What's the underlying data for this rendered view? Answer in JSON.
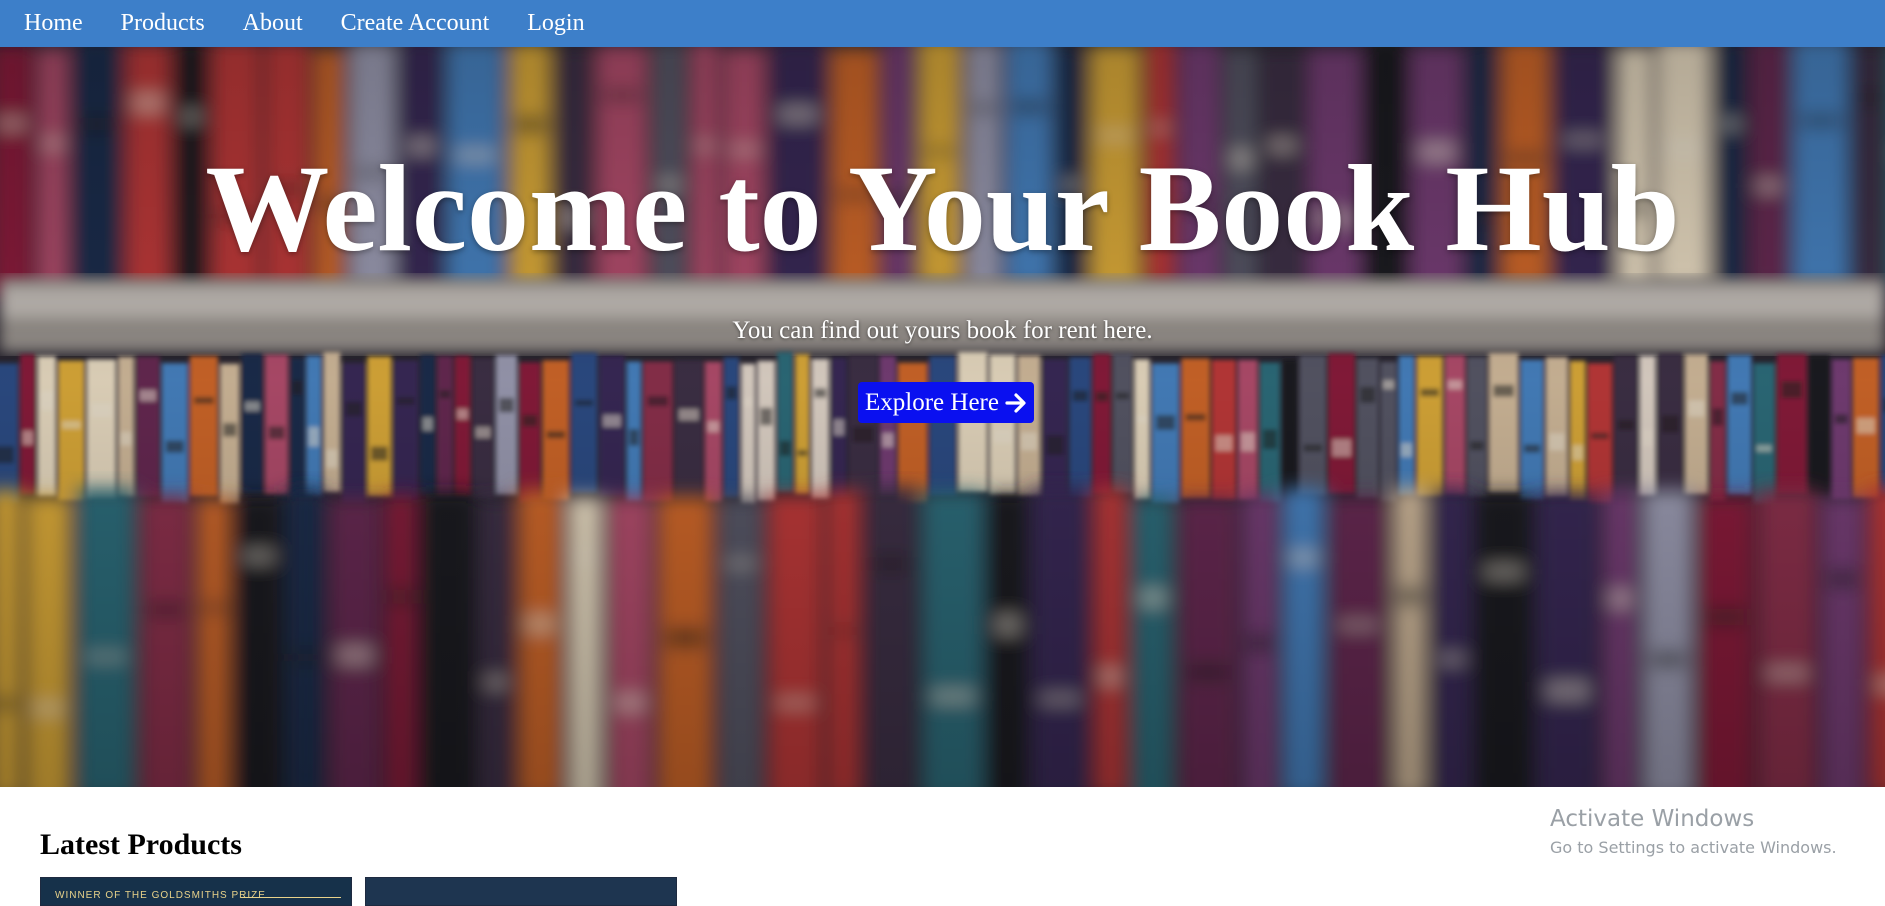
{
  "nav": {
    "items": [
      {
        "label": "Home"
      },
      {
        "label": "Products"
      },
      {
        "label": "About"
      },
      {
        "label": "Create Account"
      },
      {
        "label": "Login"
      }
    ],
    "bg_color": "#3d7fc9"
  },
  "hero": {
    "title": "Welcome to Your Book Hub",
    "subtitle": "You can find out yours book for rent here.",
    "cta_label": "Explore Here",
    "cta_icon": "arrow-right-icon",
    "cta_color": "#0a10f0",
    "background": "blurred-bookshelf-photo"
  },
  "latest": {
    "title": "Latest Products",
    "products": [
      {
        "cover_text": "WINNER OF THE GOLDSMITHS PRIZE"
      },
      {
        "cover_text": ""
      }
    ]
  },
  "watermark": {
    "title": "Activate Windows",
    "subtitle": "Go to Settings to activate Windows."
  }
}
